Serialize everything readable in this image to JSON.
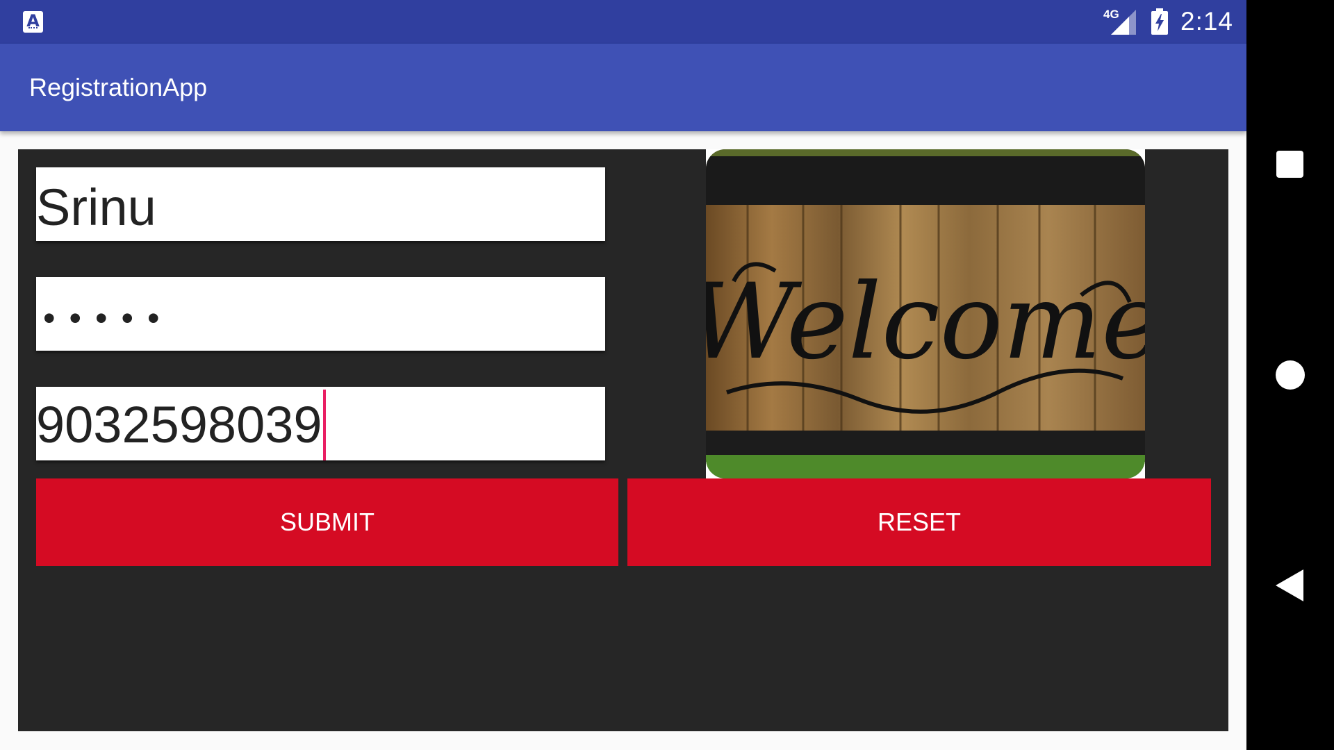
{
  "status_bar": {
    "network": "4G",
    "time": "2:14",
    "notification_icon": "app-notification-icon",
    "notification_letter": "A"
  },
  "app_bar": {
    "title": "RegistrationApp"
  },
  "form": {
    "name_value": "Srinu",
    "password_value": "12345",
    "phone_value": "9032598039",
    "submit_label": "SUBMIT",
    "reset_label": "RESET"
  },
  "image": {
    "icon": "welcome-sign-image",
    "lettering": "Welcome"
  },
  "colors": {
    "status_bar": "#303f9f",
    "app_bar": "#3f51b5",
    "panel": "#262626",
    "button": "#d50b23",
    "caret": "#e91e63"
  },
  "nav_bar": {
    "icons": [
      "recents-icon",
      "home-icon",
      "back-icon"
    ]
  }
}
